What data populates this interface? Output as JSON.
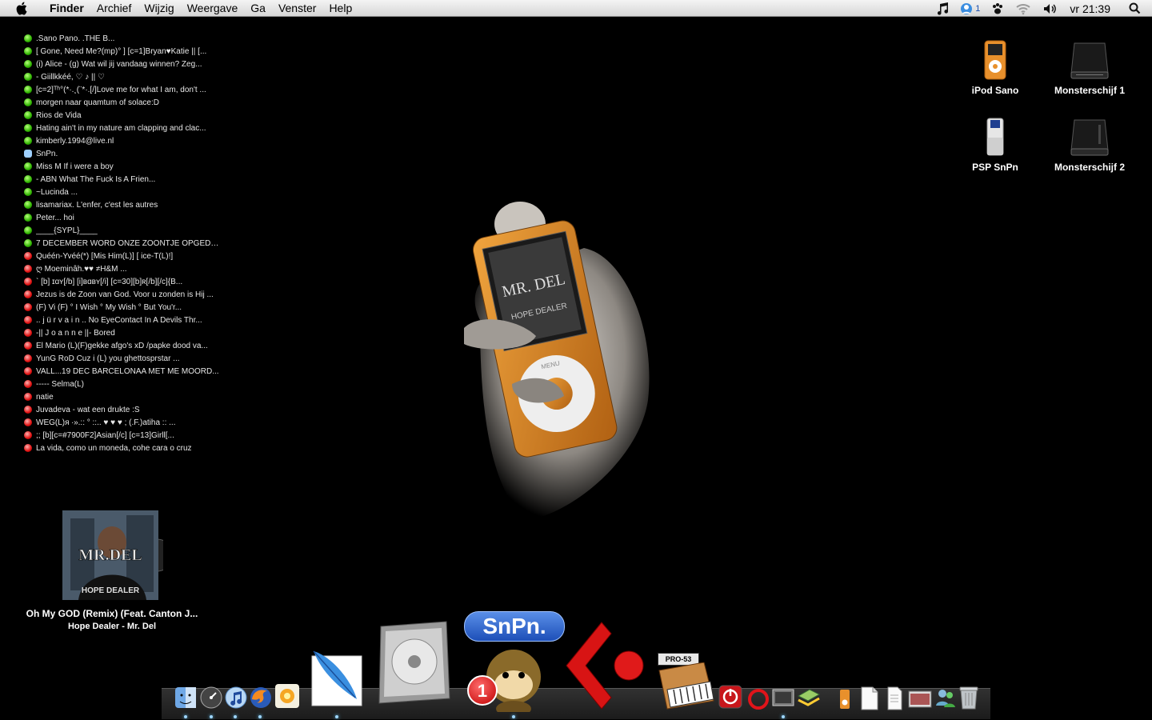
{
  "menubar": {
    "app_name": "Finder",
    "menus": [
      "Archief",
      "Wijzig",
      "Weergave",
      "Ga",
      "Venster",
      "Help"
    ],
    "status_badge": "1",
    "clock": "vr 21:39"
  },
  "buddies": [
    {
      "status": "online",
      "name": ".Sano Pano.                              .THE B..."
    },
    {
      "status": "online",
      "name": "[ Gone, Need Me?(mp)° ] [c=1]Bryan♥Katie || [..."
    },
    {
      "status": "online",
      "name": "  (i) Alice - (g) Wat wil jij vandaag winnen? Zeg..."
    },
    {
      "status": "online",
      "name": "-              Giillkkéé,  ♡ ♪    ||        ♡"
    },
    {
      "status": "online",
      "name": "[c=2]ᵀʰ°(*·.¸(¨*·.[/]Love me for what I am, don't ..."
    },
    {
      "status": "online",
      "name": "morgen naar quamtum of solace:D"
    },
    {
      "status": "online",
      "name": "Rios de Vida"
    },
    {
      "status": "online",
      "name": "Hating ain't in my nature am clapping and clac..."
    },
    {
      "status": "online",
      "name": "kimberly.1994@live.nl"
    },
    {
      "status": "mobile",
      "name": "SnPn."
    },
    {
      "status": "online",
      "name": "Miss M       If i were a boy"
    },
    {
      "status": "online",
      "name": "-                         ABN     What The Fuck Is A Frien..."
    },
    {
      "status": "online",
      "name": "~Lucinda ..."
    },
    {
      "status": "online",
      "name": "lisamariax.              L'enfer, c'est les autres"
    },
    {
      "status": "online",
      "name": "Peter... hoi"
    },
    {
      "status": "online",
      "name": "____{SYPL}____"
    },
    {
      "status": "online",
      "name": "7 DECEMBER WORD ONZE ZOONTJE OPGEDR..."
    },
    {
      "status": "busy",
      "name": "Quéén-Yvéé(*)            [Mis Him(L)]        [ ice-T(L)!]"
    },
    {
      "status": "busy",
      "name": "ღ    Moeminâh.♥♥                                    ≠H&M ..."
    },
    {
      "status": "busy",
      "name": "`  [b]   ɪɑʏ[/b] [i]вɑвʏ[/i]  [c=30][b]ʀ[/b][/c]{B..."
    },
    {
      "status": "busy",
      "name": "Jezus is de Zoon van God. Voor u zonden is Hij ..."
    },
    {
      "status": "busy",
      "name": "(F) Vi (F)               ° I Wish ° My Wish ° But You'r..."
    },
    {
      "status": "busy",
      "name": ".. j ü r v a i n ..    No EyeContact In A Devils Thr..."
    },
    {
      "status": "busy",
      "name": "-||  J o a n n e  ||-  Bored"
    },
    {
      "status": "busy",
      "name": "El Mario (L)(F)gekke  afgo's xD /papke dood va..."
    },
    {
      "status": "busy",
      "name": "YunG RoD                 Cuz i (L) you ghettosprstar ..."
    },
    {
      "status": "busy",
      "name": "VALL...19 DEC BARCELONAA MET ME MOORD..."
    },
    {
      "status": "busy",
      "name": "-----                    Selma(L)"
    },
    {
      "status": "busy",
      "name": "natie"
    },
    {
      "status": "busy",
      "name": "Juvadeva -                             wat een drukte :S"
    },
    {
      "status": "busy",
      "name": "WEG(L)ᴙ ∙».:: ° ::.. ♥ ♥ ♥  ; (.F.)atiha ::          ..."
    },
    {
      "status": "busy",
      "name": ";;            [b][c=#7900F2]Asian[/c]  [c=13]Girll[..."
    },
    {
      "status": "busy",
      "name": "La vida, como un moneda, cohe cara o cruz"
    }
  ],
  "desktop_icons": [
    {
      "name": "ipod-sano",
      "label": "iPod Sano"
    },
    {
      "name": "monsterschijf-1",
      "label": "Monsterschijf 1"
    },
    {
      "name": "psp-snpn",
      "label": "PSP SnPn"
    },
    {
      "name": "monsterschijf-2",
      "label": "Monsterschijf 2"
    }
  ],
  "wallpaper": {
    "screen_text": "MR. DEL",
    "sub_text": "HOPE DEALER",
    "menu_label": "MENU"
  },
  "now_playing": {
    "album_title": "MR.DEL",
    "album_sub": "HOPE DEALER",
    "track": "Oh My GOD (Remix) (Feat. Canton J...",
    "subtitle": "Hope Dealer - Mr. Del"
  },
  "dock": {
    "snpn_label": "SnPn.",
    "snpn_badge": "1",
    "pro53_label": "PRO-53"
  },
  "colors": {
    "online": "#2fb400",
    "busy": "#e01010",
    "accent": "#2c5fc0",
    "cubase": "#e01a1a",
    "ipod_orange": "#e8902c"
  }
}
